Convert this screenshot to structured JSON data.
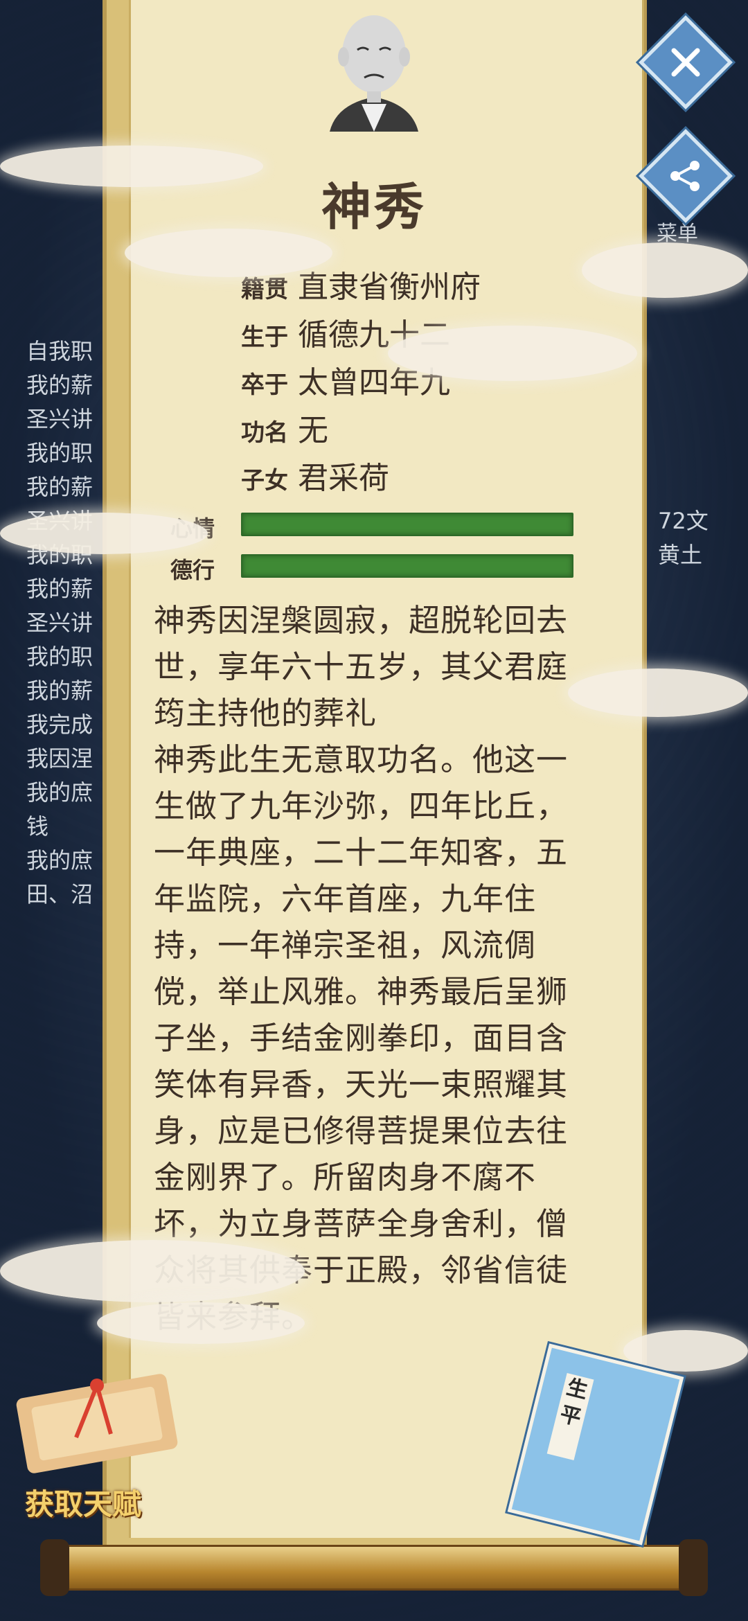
{
  "character": {
    "name": "神秀",
    "fields": [
      {
        "key": "籍贯",
        "value": "直隶省衡州府"
      },
      {
        "key": "生于",
        "value": "循德九十二"
      },
      {
        "key": "卒于",
        "value": "太曾四年九"
      },
      {
        "key": "功名",
        "value": "无"
      },
      {
        "key": "子女",
        "value": "君采荷"
      }
    ],
    "meters": [
      {
        "label": "心情",
        "level": 1.0
      },
      {
        "label": "德行",
        "level": 1.0
      }
    ],
    "bio": "神秀因涅槃圆寂，超脱轮回去世，享年六十五岁，其父君庭筠主持他的葬礼\n神秀此生无意取功名。他这一生做了九年沙弥，四年比丘，一年典座，二十二年知客，五年监院，六年首座，九年住持，一年禅宗圣祖，风流倜傥，举止风雅。神秀最后呈狮子坐，手结金刚拳印，面目含笑体有异香，天光一束照耀其身，应是已修得菩提果位去往金刚界了。所留肉身不腐不坏，为立身菩萨全身舍利，僧众将其供奉于正殿，邻省信徒皆来参拜。"
  },
  "background_log": [
    "自我职",
    "我的薪",
    "圣兴讲",
    "我的职",
    "我的薪",
    "圣兴讲",
    "我的职",
    "我的薪",
    "圣兴讲",
    "我的职",
    "我的薪",
    "我完成",
    "我因涅",
    "我的庶",
    "钱",
    "我的庶",
    "田、沼"
  ],
  "background_right": {
    "line_13": "72文",
    "line_15": "黄土"
  },
  "buttons": {
    "close_icon": "close-icon",
    "share_icon": "share-icon",
    "menu_label": "菜单",
    "talent_label": "获取天赋",
    "book_title": "生平"
  },
  "colors": {
    "paper": "#f2e8c2",
    "frame": "#d9c078",
    "meter_green": "#3f8a35",
    "text": "#3d3026",
    "accent_blue": "#5b8fc4"
  }
}
